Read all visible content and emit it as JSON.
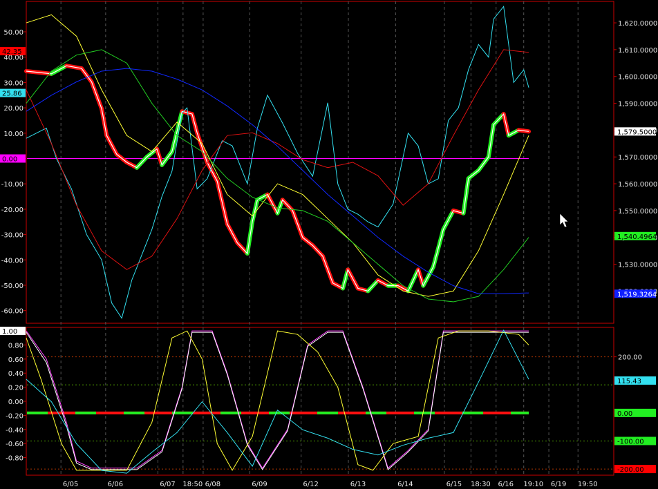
{
  "chart_data": [
    {
      "type": "line",
      "panel": "price",
      "title": "",
      "left_axis": {
        "ylim": [
          -65,
          62
        ],
        "ticks": [
          50,
          40,
          30,
          20,
          10,
          0,
          -10,
          -20,
          -30,
          -40,
          -50,
          -60
        ],
        "tick_labels": [
          "50.00",
          "40.00",
          "30.00",
          "20.00",
          "10.00",
          "0.00",
          "-10.00",
          "-20.00",
          "-30.00",
          "-40.00",
          "-50.00",
          "-60.00"
        ]
      },
      "right_axis": {
        "ylim": [
          1508000,
          1628000
        ],
        "ticks": [
          1620000,
          1610000,
          1600000,
          1590000,
          1580000,
          1570000,
          1560000,
          1550000,
          1540000,
          1530000,
          1520000
        ],
        "tick_labels": [
          "1,620.0000",
          "1,610.0000",
          "1,600.0000",
          "1,590.0000",
          "1,580.0000",
          "1,570.0000",
          "1,560.0000",
          "1,550.0000",
          "1,540.0000",
          "1,530.0000",
          "1,520.0000"
        ]
      },
      "x_ticks": [
        {
          "x": 0.069,
          "label": "6/05"
        },
        {
          "x": 0.158,
          "label": "6/06"
        },
        {
          "x": 0.262,
          "label": "6/07"
        },
        {
          "x": 0.312,
          "label": "18:50"
        },
        {
          "x": 0.352,
          "label": "6/08"
        },
        {
          "x": 0.445,
          "label": "6/09"
        },
        {
          "x": 0.547,
          "label": "6/12"
        },
        {
          "x": 0.641,
          "label": "6/13"
        },
        {
          "x": 0.735,
          "label": "6/14"
        },
        {
          "x": 0.832,
          "label": "6/15"
        },
        {
          "x": 0.885,
          "label": "18:30"
        },
        {
          "x": 0.935,
          "label": "6/16"
        },
        {
          "x": 0.99,
          "label": "19:10"
        },
        {
          "x": 1.04,
          "label": "6/19"
        },
        {
          "x": 1.098,
          "label": "19:50"
        }
      ],
      "value_tags": [
        {
          "side": "left",
          "value": 42.35,
          "label": "42.35",
          "bg": "#ff0000",
          "fg": "#000000"
        },
        {
          "side": "left",
          "value": 25.86,
          "label": "25.86",
          "bg": "#33e0f0",
          "fg": "#000000"
        },
        {
          "side": "left",
          "value": 0.0,
          "label": "0.00",
          "bg": "#ff00ff",
          "fg": "#000000"
        },
        {
          "side": "right",
          "value": 1579500,
          "label": "1,579.5000",
          "bg": "#ffffff",
          "fg": "#000000"
        },
        {
          "side": "right",
          "value": 1540496,
          "label": "1,540.4964",
          "bg": "#22ee22",
          "fg": "#000000"
        },
        {
          "side": "right",
          "value": 1519000,
          "label": "1,519.3264",
          "bg": "#1020ff",
          "fg": "#ffffff"
        }
      ],
      "hline": {
        "value": 0,
        "color": "#ff00ff"
      },
      "series": [
        {
          "axis": "right",
          "color": "#ffffff",
          "style": "price",
          "up_color": "#22ee22",
          "down_color": "#ff1010",
          "x": [
            0.0,
            0.05,
            0.08,
            0.11,
            0.13,
            0.15,
            0.16,
            0.18,
            0.2,
            0.22,
            0.24,
            0.26,
            0.27,
            0.29,
            0.31,
            0.33,
            0.34,
            0.36,
            0.38,
            0.4,
            0.42,
            0.44,
            0.45,
            0.46,
            0.48,
            0.5,
            0.51,
            0.53,
            0.55,
            0.57,
            0.59,
            0.61,
            0.63,
            0.64,
            0.66,
            0.68,
            0.7,
            0.72,
            0.74,
            0.76,
            0.78,
            0.79,
            0.81,
            0.83,
            0.85,
            0.87,
            0.88,
            0.9,
            0.92,
            0.93,
            0.95,
            0.96,
            0.98,
            1.0
          ],
          "y": [
            1602000,
            1601000,
            1604000,
            1603000,
            1598000,
            1588000,
            1578000,
            1571000,
            1568000,
            1566000,
            1570000,
            1573000,
            1567000,
            1572000,
            1587000,
            1586000,
            1579000,
            1568000,
            1561000,
            1545000,
            1538000,
            1534000,
            1546000,
            1554000,
            1556000,
            1549000,
            1554000,
            1550000,
            1540000,
            1537000,
            1533000,
            1523000,
            1521000,
            1528000,
            1521000,
            1520000,
            1524000,
            1522000,
            1522000,
            1520000,
            1528000,
            1522000,
            1529000,
            1543000,
            1550000,
            1549000,
            1562000,
            1565000,
            1570000,
            1582000,
            1586000,
            1578000,
            1580000,
            1579500
          ]
        },
        {
          "axis": "left",
          "color": "#33e0f0",
          "label_value": 25.86,
          "x": [
            0.0,
            0.04,
            0.06,
            0.09,
            0.12,
            0.15,
            0.17,
            0.19,
            0.21,
            0.23,
            0.25,
            0.27,
            0.29,
            0.31,
            0.32,
            0.34,
            0.36,
            0.39,
            0.41,
            0.44,
            0.46,
            0.48,
            0.51,
            0.54,
            0.57,
            0.6,
            0.62,
            0.64,
            0.66,
            0.68,
            0.7,
            0.73,
            0.76,
            0.78,
            0.8,
            0.82,
            0.84,
            0.86,
            0.88,
            0.9,
            0.92,
            0.93,
            0.95,
            0.97,
            0.99,
            1.0
          ],
          "y": [
            8,
            12,
            0,
            -12,
            -30,
            -40,
            -57,
            -63,
            -48,
            -38,
            -28,
            -15,
            -5,
            18,
            20,
            -12,
            -8,
            7,
            5,
            -10,
            12,
            25,
            14,
            2,
            -7,
            22,
            -10,
            -20,
            -22,
            -25,
            -27,
            -18,
            10,
            5,
            -10,
            -8,
            15,
            20,
            35,
            45,
            40,
            55,
            60,
            30,
            35,
            28
          ]
        },
        {
          "axis": "right",
          "color": "#dd1111",
          "x": [
            0.0,
            0.05,
            0.1,
            0.15,
            0.2,
            0.25,
            0.3,
            0.35,
            0.4,
            0.45,
            0.5,
            0.55,
            0.6,
            0.65,
            0.7,
            0.75,
            0.8,
            0.85,
            0.9,
            0.95,
            1.0
          ],
          "y": [
            1595000,
            1575000,
            1552000,
            1535000,
            1528000,
            1533000,
            1547000,
            1565000,
            1578000,
            1579000,
            1575000,
            1569000,
            1566000,
            1568000,
            1563000,
            1552000,
            1560000,
            1578000,
            1595000,
            1610000,
            1609000
          ]
        },
        {
          "axis": "right",
          "color": "#ffff33",
          "x": [
            0.0,
            0.05,
            0.1,
            0.15,
            0.2,
            0.25,
            0.3,
            0.35,
            0.4,
            0.45,
            0.5,
            0.55,
            0.6,
            0.65,
            0.7,
            0.75,
            0.8,
            0.85,
            0.9,
            0.95,
            1.0
          ],
          "y": [
            1620000,
            1623000,
            1615000,
            1595000,
            1578000,
            1572000,
            1583000,
            1575000,
            1556000,
            1548000,
            1560000,
            1556000,
            1547000,
            1538000,
            1526000,
            1520000,
            1518000,
            1520000,
            1535000,
            1556000,
            1578000
          ]
        },
        {
          "axis": "right",
          "color": "#22cc22",
          "x": [
            0.0,
            0.05,
            0.1,
            0.15,
            0.2,
            0.25,
            0.3,
            0.35,
            0.4,
            0.45,
            0.5,
            0.55,
            0.6,
            0.65,
            0.7,
            0.75,
            0.8,
            0.85,
            0.9,
            0.95,
            1.0
          ],
          "y": [
            1590000,
            1602000,
            1608000,
            1610000,
            1605000,
            1590000,
            1578000,
            1572000,
            1562000,
            1555000,
            1551000,
            1550000,
            1546000,
            1538000,
            1530000,
            1522000,
            1517000,
            1516000,
            1518000,
            1528000,
            1540000
          ]
        },
        {
          "axis": "right",
          "color": "#1028ff",
          "x": [
            0.0,
            0.05,
            0.1,
            0.15,
            0.2,
            0.25,
            0.3,
            0.35,
            0.4,
            0.45,
            0.5,
            0.55,
            0.6,
            0.65,
            0.7,
            0.75,
            0.8,
            0.85,
            0.9,
            0.95,
            1.0
          ],
          "y": [
            1587000,
            1593000,
            1598000,
            1602000,
            1603000,
            1602000,
            1599000,
            1595000,
            1589000,
            1582000,
            1574000,
            1565000,
            1556000,
            1548000,
            1540000,
            1533000,
            1527000,
            1522000,
            1519000,
            1519000,
            1519300
          ]
        }
      ]
    },
    {
      "type": "line",
      "panel": "oscillator",
      "left_axis": {
        "ylim": [
          -1.05,
          1.05
        ],
        "ticks": [
          1.0,
          0.8,
          0.6,
          0.4,
          0.2,
          0.0,
          -0.2,
          -0.4,
          -0.6,
          -0.8
        ],
        "tick_labels": [
          "1.00",
          "0.80",
          "0.60",
          "0.40",
          "0.20",
          "0.00",
          "-0.20",
          "-0.40",
          "-0.60",
          "-0.80"
        ]
      },
      "right_axis": {
        "ylim": [
          -222,
          305
        ],
        "ticks": [
          200
        ],
        "tick_labels": [
          "200.00"
        ]
      },
      "value_tags": [
        {
          "side": "left",
          "value": 1.0,
          "label": "1.00",
          "bg": "#ffffff",
          "fg": "#000000"
        },
        {
          "side": "right",
          "value": 115.43,
          "label": "115.43",
          "bg": "#33e0f0",
          "fg": "#000000"
        },
        {
          "side": "right",
          "value": 0.0,
          "label": "0.00",
          "bg": "#22ee22",
          "fg": "#000000"
        },
        {
          "side": "right",
          "value": -100.0,
          "label": "-100.00",
          "bg": "#22ee22",
          "fg": "#000000"
        },
        {
          "side": "right",
          "value": -200.0,
          "label": "-200.00",
          "bg": "#ff0000",
          "fg": "#000000"
        }
      ],
      "levels": [
        {
          "axis": "right",
          "value": 200,
          "color": "#aa3300",
          "dash": true
        },
        {
          "axis": "right",
          "value": 100,
          "color": "#55aa00",
          "dash": true
        },
        {
          "axis": "right",
          "value": -100,
          "color": "#55aa00",
          "dash": true
        },
        {
          "axis": "right",
          "value": -200,
          "color": "#aa3300",
          "dash": true
        },
        {
          "axis": "right",
          "value": 0,
          "color": "#22ee22",
          "thick": true,
          "alt_color": "#ff1010"
        }
      ],
      "series": [
        {
          "axis": "left",
          "color": "#ff44ff",
          "x": [
            0.0,
            0.04,
            0.08,
            0.1,
            0.13,
            0.22,
            0.27,
            0.31,
            0.33,
            0.37,
            0.4,
            0.44,
            0.47,
            0.52,
            0.56,
            0.6,
            0.63,
            0.67,
            0.72,
            0.76,
            0.8,
            0.83,
            0.88,
            0.95,
            1.0
          ],
          "y": [
            1.0,
            0.6,
            -0.3,
            -0.85,
            -0.95,
            -0.95,
            -0.7,
            0.2,
            1.0,
            1.0,
            0.4,
            -0.6,
            -0.95,
            -0.4,
            0.8,
            1.0,
            1.0,
            0.2,
            -0.95,
            -0.7,
            -0.4,
            1.0,
            1.0,
            1.0,
            1.0
          ]
        },
        {
          "axis": "left",
          "color": "#ffffff",
          "x": [
            0.0,
            0.04,
            0.08,
            0.1,
            0.13,
            0.22,
            0.27,
            0.31,
            0.33,
            0.37,
            0.4,
            0.44,
            0.47,
            0.52,
            0.56,
            0.6,
            0.63,
            0.67,
            0.72,
            0.76,
            0.8,
            0.83,
            0.88,
            0.95,
            1.0
          ],
          "y": [
            0.98,
            0.55,
            -0.35,
            -0.88,
            -0.97,
            -0.97,
            -0.72,
            0.18,
            0.98,
            0.98,
            0.38,
            -0.62,
            -0.97,
            -0.42,
            0.78,
            0.98,
            0.98,
            0.18,
            -0.97,
            -0.72,
            -0.42,
            0.98,
            0.98,
            0.98,
            0.98
          ]
        },
        {
          "axis": "left",
          "color": "#ffff33",
          "x": [
            0.0,
            0.03,
            0.07,
            0.1,
            0.2,
            0.25,
            0.29,
            0.32,
            0.35,
            0.38,
            0.41,
            0.45,
            0.5,
            0.54,
            0.58,
            0.62,
            0.66,
            0.69,
            0.73,
            0.78,
            0.82,
            0.86,
            0.92,
            0.98,
            1.0
          ],
          "y": [
            0.9,
            0.3,
            -0.6,
            -0.98,
            -0.98,
            -0.3,
            0.9,
            1.0,
            0.6,
            -0.6,
            -0.98,
            -0.5,
            1.0,
            0.95,
            0.7,
            0.2,
            -0.9,
            -0.98,
            -0.6,
            -0.5,
            0.9,
            1.0,
            1.0,
            0.95,
            0.8
          ]
        },
        {
          "axis": "right",
          "color": "#33e0f0",
          "x": [
            0.0,
            0.05,
            0.1,
            0.15,
            0.2,
            0.25,
            0.3,
            0.35,
            0.4,
            0.45,
            0.5,
            0.55,
            0.6,
            0.65,
            0.7,
            0.75,
            0.8,
            0.85,
            0.9,
            0.95,
            1.0
          ],
          "y": [
            120,
            40,
            -110,
            -205,
            -215,
            -140,
            -70,
            40,
            -70,
            -190,
            10,
            -60,
            -90,
            -130,
            -150,
            -115,
            -90,
            -70,
            110,
            295,
            120
          ]
        }
      ]
    }
  ]
}
